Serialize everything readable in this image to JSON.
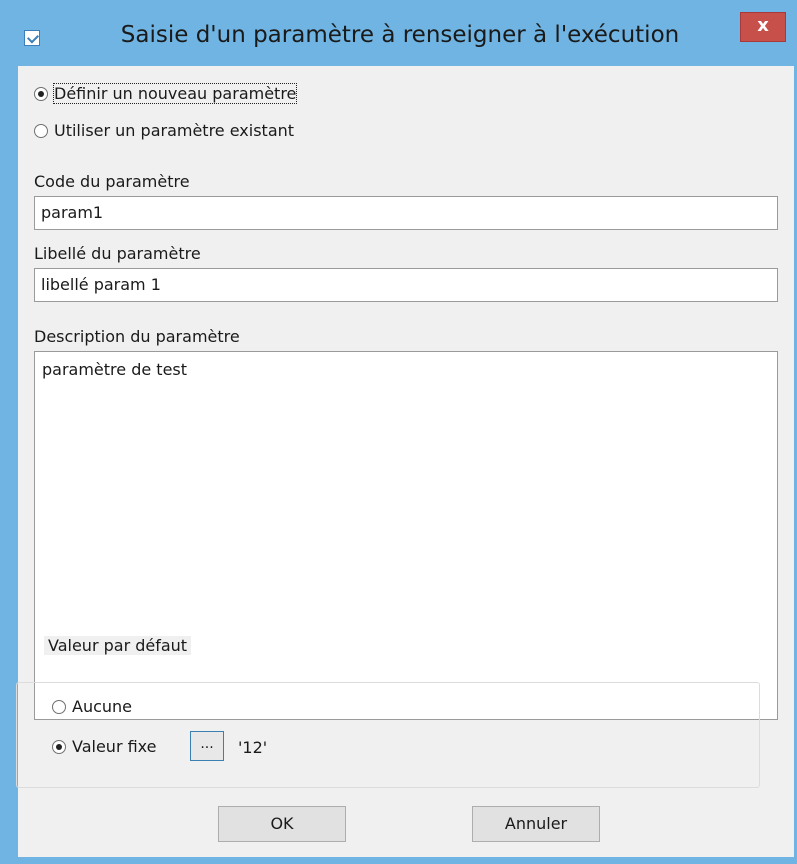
{
  "window": {
    "title": "Saisie d'un paramètre à renseigner à l'exécution",
    "close_label": "x"
  },
  "mode": {
    "option_new": "Définir un nouveau paramètre",
    "option_existing": "Utiliser un paramètre existant",
    "selected": "new"
  },
  "fields": {
    "code_label": "Code du paramètre",
    "code_value": "param1",
    "libelle_label": "Libellé du paramètre",
    "libelle_value": "libellé param 1",
    "description_label": "Description du paramètre",
    "description_value": "paramètre de test"
  },
  "default_value": {
    "legend": "Valeur par défaut",
    "option_none": "Aucune",
    "option_fixed": "Valeur fixe",
    "selected": "fixed",
    "browse_label": "...",
    "fixed_value": "'12'"
  },
  "buttons": {
    "ok": "OK",
    "cancel": "Annuler"
  },
  "colors": {
    "titlebar": "#6fb4e2",
    "close": "#c7504b",
    "client": "#f0f0f0"
  },
  "icons": {
    "app": "app-icon",
    "close": "close-icon"
  }
}
